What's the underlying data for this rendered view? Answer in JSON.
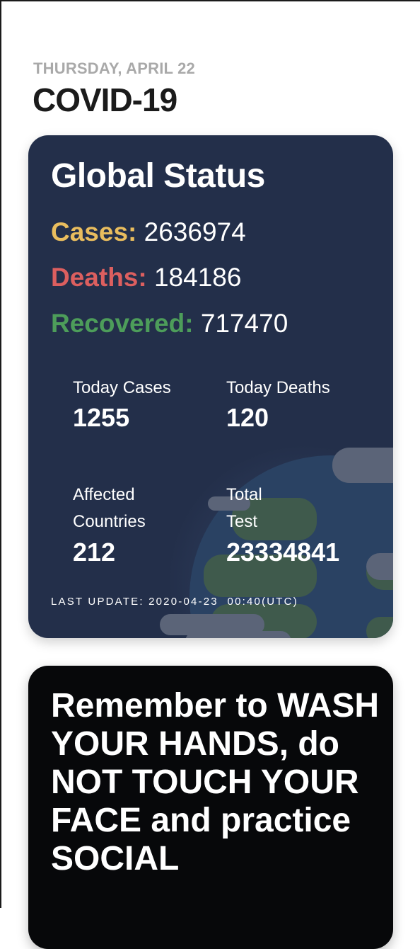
{
  "header": {
    "date": "THURSDAY, APRIL 22",
    "title": "COVID-19"
  },
  "global_status": {
    "heading": "Global Status",
    "cases_label": "Cases:",
    "cases_value": "2636974",
    "deaths_label": "Deaths:",
    "deaths_value": "184186",
    "recovered_label": "Recovered:",
    "recovered_value": "717470",
    "today_cases_label": "Today Cases",
    "today_cases_value": "1255",
    "today_deaths_label": "Today Deaths",
    "today_deaths_value": "120",
    "affected_label_line1": "Affected",
    "affected_label_line2": "Countries",
    "affected_value": "212",
    "total_test_label_line1": "Total",
    "total_test_label_line2": "Test",
    "total_test_value": "23334841",
    "last_update": "LAST UPDATE: 2020-04-23  00:40(UTC)"
  },
  "message_card": {
    "text": "Remember to WASH YOUR HANDS, do NOT TOUCH YOUR FACE and practice SOCIAL"
  },
  "colors": {
    "cases": "#e9bd5e",
    "deaths": "#dc5f5f",
    "recovered": "#4d9d5a",
    "card_bg": "#232f4a",
    "message_bg": "#07080a"
  },
  "icons": {
    "card_illustration": "globe-with-clouds"
  }
}
